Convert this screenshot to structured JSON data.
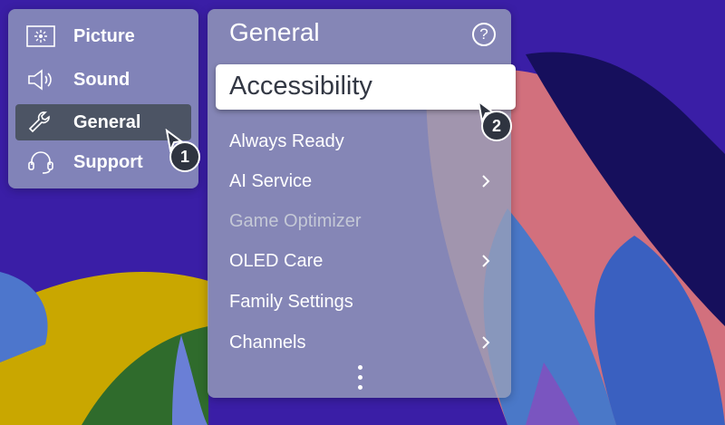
{
  "left_menu": {
    "items": [
      {
        "label": "Picture",
        "icon": "picture-icon"
      },
      {
        "label": "Sound",
        "icon": "speaker-icon"
      },
      {
        "label": "General",
        "icon": "wrench-icon",
        "selected": true
      },
      {
        "label": "Support",
        "icon": "headset-icon"
      }
    ]
  },
  "general_menu": {
    "title": "General",
    "help": "?",
    "highlighted": "Accessibility",
    "items": [
      {
        "label": "Always Ready",
        "chevron": false,
        "disabled": false
      },
      {
        "label": "AI Service",
        "chevron": true,
        "disabled": false
      },
      {
        "label": "Game Optimizer",
        "chevron": false,
        "disabled": true
      },
      {
        "label": "OLED Care",
        "chevron": true,
        "disabled": false
      },
      {
        "label": "Family Settings",
        "chevron": false,
        "disabled": false
      },
      {
        "label": "Channels",
        "chevron": true,
        "disabled": false
      }
    ]
  },
  "callouts": {
    "step1": "1",
    "step2": "2"
  },
  "colors": {
    "background": "#3b1ea6",
    "selected_item": "#4c5464",
    "highlight": "#ffffff"
  }
}
